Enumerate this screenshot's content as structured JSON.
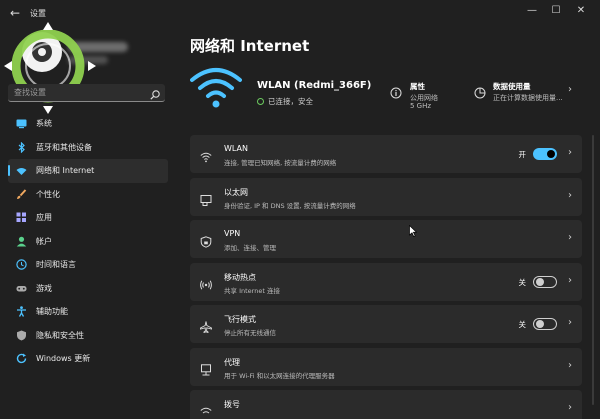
{
  "window": {
    "title": "设置",
    "back_glyph": "←",
    "minimize_glyph": "—",
    "maximize_glyph": "☐",
    "close_glyph": "✕"
  },
  "search": {
    "placeholder": "查找设置"
  },
  "sidebar": {
    "items": [
      {
        "label": "系统",
        "icon": "system-icon",
        "color": "#4cc2ff"
      },
      {
        "label": "蓝牙和其他设备",
        "icon": "bluetooth-icon",
        "color": "#4cc2ff"
      },
      {
        "label": "网络和 Internet",
        "icon": "network-icon",
        "color": "#4cc2ff",
        "active": true
      },
      {
        "label": "个性化",
        "icon": "brush-icon",
        "color": "#f0a860"
      },
      {
        "label": "应用",
        "icon": "apps-icon",
        "color": "#a6a6ff"
      },
      {
        "label": "帐户",
        "icon": "account-icon",
        "color": "#5ad18c"
      },
      {
        "label": "时间和语言",
        "icon": "globe-clock-icon",
        "color": "#4cc2ff"
      },
      {
        "label": "游戏",
        "icon": "gamepad-icon",
        "color": "#aaaaaa"
      },
      {
        "label": "辅助功能",
        "icon": "accessibility-icon",
        "color": "#4cc2ff"
      },
      {
        "label": "隐私和安全性",
        "icon": "shield-icon",
        "color": "#aaaaaa"
      },
      {
        "label": "Windows 更新",
        "icon": "update-icon",
        "color": "#4cc2ff"
      }
    ]
  },
  "main": {
    "title": "网络和 Internet",
    "hero": {
      "name": "WLAN (Redmi_366F)",
      "status": "已连接，安全",
      "properties": {
        "title": "属性",
        "line1": "公用网络",
        "line2": "5 GHz"
      },
      "usage": {
        "title": "数据使用量",
        "line1": "正在计算数据使用量..."
      }
    },
    "cards": [
      {
        "title": "WLAN",
        "subtitle": "连接, 管理已知网络, 按流量计费的网络",
        "icon": "wifi-icon",
        "toggle": "on",
        "state": "开"
      },
      {
        "title": "以太网",
        "subtitle": "身份验证, IP 和 DNS 设置, 按流量计费的网络",
        "icon": "ethernet-icon"
      },
      {
        "title": "VPN",
        "subtitle": "添加、连接、管理",
        "icon": "vpn-shield-icon"
      },
      {
        "title": "移动热点",
        "subtitle": "共享 Internet 连接",
        "icon": "hotspot-icon",
        "toggle": "off",
        "state": "关"
      },
      {
        "title": "飞行模式",
        "subtitle": "停止所有无线通信",
        "icon": "airplane-icon",
        "toggle": "off",
        "state": "关"
      },
      {
        "title": "代理",
        "subtitle": "用于 Wi-Fi 和以太网连接的代理服务器",
        "icon": "proxy-icon"
      },
      {
        "title": "拨号",
        "subtitle": "",
        "icon": "dialup-icon"
      }
    ]
  },
  "colors": {
    "accent": "#4cc2ff",
    "background": "#202020",
    "card": "#2b2b2b"
  }
}
